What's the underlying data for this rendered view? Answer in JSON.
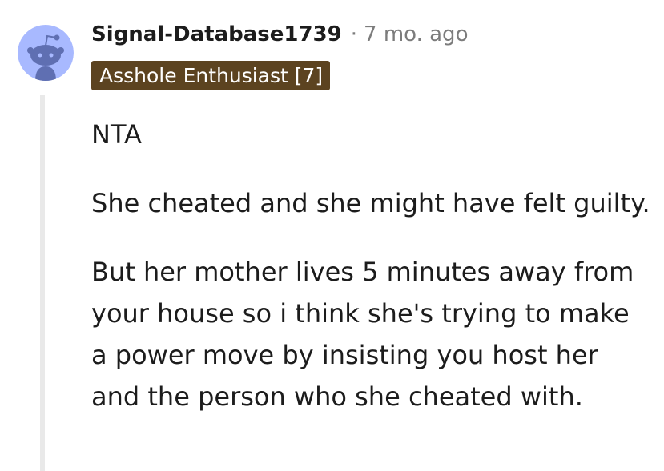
{
  "comment": {
    "author": "Signal-Database1739",
    "separator": "·",
    "timestamp": "7 mo. ago",
    "flair": "Asshole Enthusiast [7]",
    "paragraphs": [
      "NTA",
      "She cheated and she might have felt guilty.",
      "But her mother lives 5 minutes away from your house so i think she's trying to make a power move by insisting you host her and the person who she cheated with."
    ]
  },
  "colors": {
    "avatar_bg": "#a8b9ff",
    "flair_bg": "#5c4320",
    "meta_gray": "#7c7c7c",
    "thread_line": "#e9e9e9"
  },
  "icons": {
    "avatar": "snoo-avatar-icon"
  }
}
